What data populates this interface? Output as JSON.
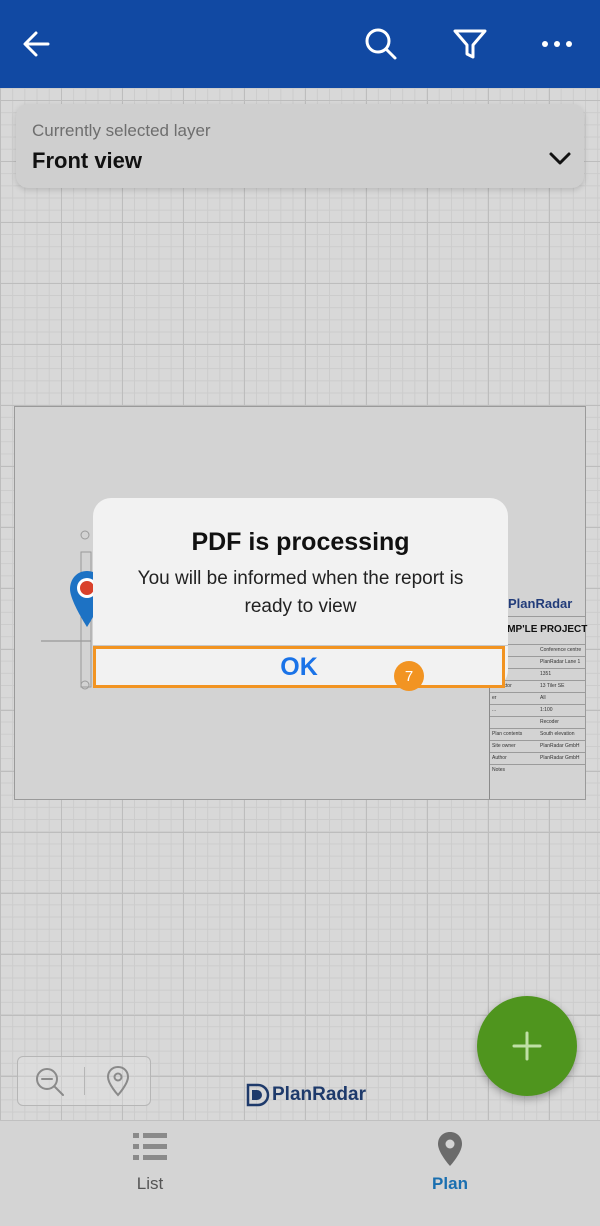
{
  "header": {
    "back_icon": "arrow-left-icon",
    "search_icon": "search-icon",
    "filter_icon": "filter-icon",
    "more_icon": "more-horizontal-icon"
  },
  "layer_selector": {
    "label": "Currently selected layer",
    "value": "Front view",
    "chevron_icon": "chevron-down-icon"
  },
  "plan_sheet": {
    "brand": "PlanRadar",
    "project_title": "AMP'LE PROJECT",
    "rows": [
      {
        "k": "ocation",
        "v": "Conference centre"
      },
      {
        "k": "...",
        "v": "PlanRadar Lane 1"
      },
      {
        "k": "umber",
        "v": "1351"
      },
      {
        "k": "ontractor",
        "v": "13 Tiler SE"
      },
      {
        "k": "er",
        "v": "All"
      },
      {
        "k": "...",
        "v": "1:100"
      },
      {
        "k": "",
        "v": "Recoder"
      },
      {
        "k": "Plan contents",
        "v": "South elevation"
      },
      {
        "k": "Site owner",
        "v": "PlanRadar GmbH"
      },
      {
        "k": "Author",
        "v": "PlanRadar GmbH"
      },
      {
        "k": "Notes",
        "v": ""
      }
    ]
  },
  "dialog": {
    "title": "PDF is processing",
    "message": "You will be informed when the report is ready to view",
    "ok_label": "OK"
  },
  "step_badge": "7",
  "zoom_controls": {
    "zoom_out_icon": "zoom-out-icon",
    "locate_icon": "map-pin-icon"
  },
  "bottom_brand": "PlanRadar",
  "fab_icon": "plus-icon",
  "tabs": [
    {
      "label": "List",
      "icon": "list-icon",
      "active": false
    },
    {
      "label": "Plan",
      "icon": "map-pin-icon",
      "active": true
    }
  ],
  "colors": {
    "header": "#1149a3",
    "accent": "#1a73e8",
    "highlight": "#f29422",
    "fab": "#4f951e",
    "active_tab": "#1a6fb0"
  }
}
